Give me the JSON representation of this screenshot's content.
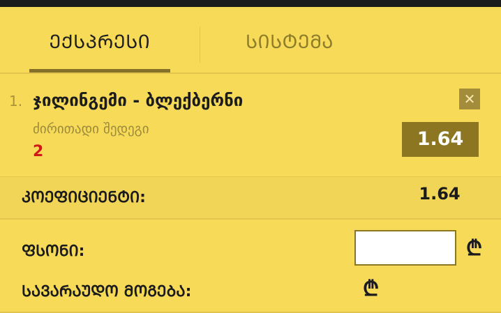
{
  "tabs": [
    {
      "label": "ᲔᲥᲡᲞᲠᲔᲡᲘ",
      "active": true
    },
    {
      "label": "ᲡᲘᲡᲢᲔᲛᲐ",
      "active": false
    }
  ],
  "bet": {
    "index": "1.",
    "match": "ჯილინგემი - ბლექბერნი",
    "market": "ძირითადი შედეგი",
    "pick": "2",
    "odds": "1.64",
    "remove_icon": "close-icon"
  },
  "summary": {
    "coefficient_label": "ᲙᲝᲔᲤᲘᲪᲘᲔᲜᲢᲘ:",
    "coefficient_value": "1.64",
    "stake_label": "ᲤᲡᲝᲜᲘ:",
    "stake_value": "",
    "potential_win_label": "ᲡᲐᲕᲐᲠᲐᲣᲓᲝ ᲛᲝᲒᲔᲑᲐ:",
    "currency_symbol": "₾"
  },
  "colors": {
    "background": "#f6da58",
    "accent_dark": "#8c7621",
    "pick": "#d11818"
  }
}
